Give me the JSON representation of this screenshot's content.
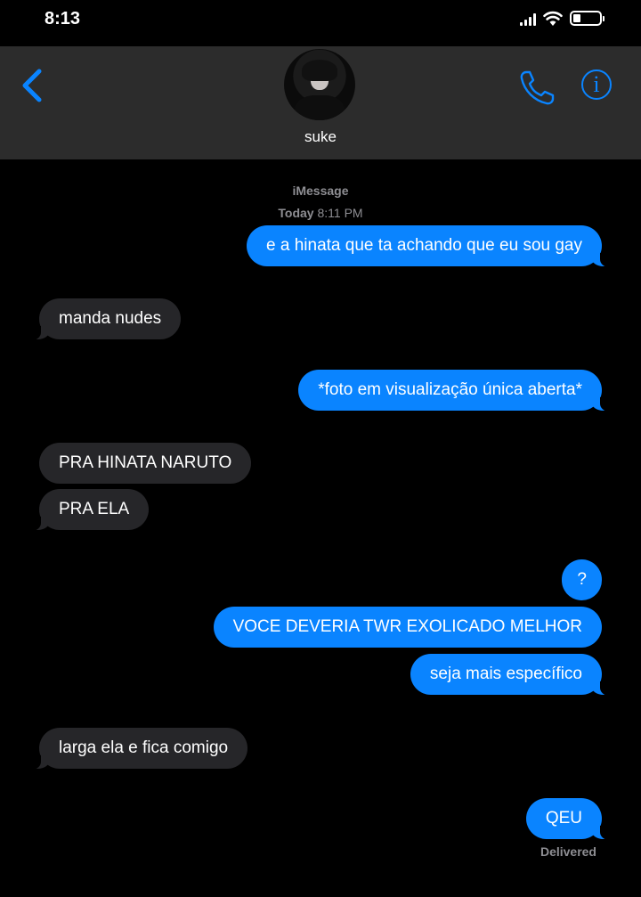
{
  "status_bar": {
    "time": "8:13"
  },
  "header": {
    "contact_name": "suke"
  },
  "thread": {
    "service": "iMessage",
    "timestamp_day": "Today",
    "timestamp_time": "8:11 PM",
    "messages": [
      {
        "direction": "sent",
        "text": "e a hinata que ta achando que eu sou gay"
      },
      {
        "direction": "received",
        "text": "manda nudes"
      },
      {
        "direction": "sent",
        "text": "*foto em visualização única aberta*"
      },
      {
        "direction": "received",
        "text": "PRA HINATA NARUTO"
      },
      {
        "direction": "received",
        "text": "PRA ELA"
      },
      {
        "direction": "sent",
        "text": "?"
      },
      {
        "direction": "sent",
        "text": "VOCE DEVERIA TWR EXOLICADO MELHOR"
      },
      {
        "direction": "sent",
        "text": "seja mais específico"
      },
      {
        "direction": "received",
        "text": "larga ela e fica comigo"
      },
      {
        "direction": "sent",
        "text": "QEU"
      }
    ],
    "delivery_status": "Delivered"
  },
  "colors": {
    "sent_bubble": "#0a84ff",
    "received_bubble": "#262629",
    "header_bg": "#2c2c2c",
    "accent": "#0a84ff"
  },
  "icons": [
    "back-chevron-icon",
    "phone-icon",
    "info-icon",
    "signal-icon",
    "wifi-icon",
    "battery-icon"
  ]
}
